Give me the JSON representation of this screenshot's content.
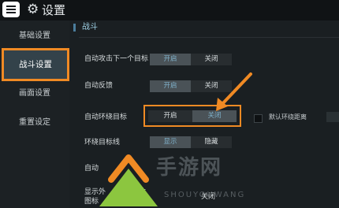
{
  "header": {
    "title": "设置",
    "menu_icon": "menu-icon",
    "settings_icon": "gear-icon"
  },
  "sidebar": {
    "items": [
      {
        "label": "基础设置"
      },
      {
        "label": "战斗设置",
        "active": true
      },
      {
        "label": "画面设置"
      },
      {
        "label": "重置设定"
      }
    ]
  },
  "section": {
    "title": "战斗"
  },
  "settings": [
    {
      "label": "自动攻击下一个目标",
      "options": [
        "开启",
        "关闭"
      ],
      "selected": "开启"
    },
    {
      "label": "自动反馈",
      "options": [
        "开启",
        "关闭"
      ],
      "selected": "开启"
    },
    {
      "label": "自动环绕目标",
      "options": [
        "开启",
        "关闭"
      ],
      "selected": "关闭"
    },
    {
      "label": "环绕目标线",
      "options": [
        "显示",
        "隐藏"
      ],
      "selected": "显示"
    },
    {
      "label": "自动",
      "partial": true
    },
    {
      "label": "显示外",
      "label_line2": "图标",
      "label_extra": "体",
      "option_visible": "关闭"
    }
  ],
  "extra_option": {
    "label": "默认环绕距离",
    "checked": false
  },
  "watermark": {
    "text": "手游网",
    "sub": "SHOUYOUWANG"
  },
  "annotation_colors": {
    "highlight": "#f08a24",
    "arrow_up": "#f08a24",
    "triangle": "#8cc63f"
  }
}
